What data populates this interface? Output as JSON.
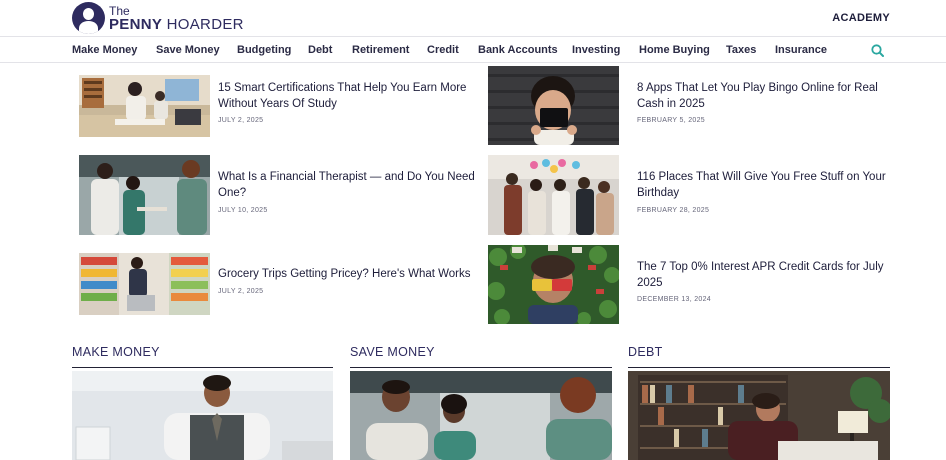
{
  "header": {
    "logo_the": "The",
    "logo_penny": "PENNY",
    "logo_hoarder": "HOARDER",
    "academy": "ACADEMY"
  },
  "nav": {
    "items": [
      "Make Money",
      "Save Money",
      "Budgeting",
      "Debt",
      "Retirement",
      "Credit",
      "Bank Accounts",
      "Investing",
      "Home Buying",
      "Taxes",
      "Insurance"
    ],
    "search_icon": "search-icon",
    "accent": "#2aa7a0"
  },
  "articles_left": [
    {
      "title": "15 Smart Certifications That Help You Earn More Without Years Of Study",
      "date": "JULY 2, 2025"
    },
    {
      "title": "What Is a Financial Therapist — and Do You Need One?",
      "date": "JULY 10, 2025"
    },
    {
      "title": "Grocery Trips Getting Pricey? Here's What Works",
      "date": "JULY 2, 2025"
    }
  ],
  "articles_right": [
    {
      "title": "8 Apps That Let You Play Bingo Online for Real Cash in 2025",
      "date": "FEBRUARY 5, 2025"
    },
    {
      "title": "116 Places That Will Give You Free Stuff on Your Birthday",
      "date": "FEBRUARY 28, 2025"
    },
    {
      "title": "The 7 Top 0% Interest APR Credit Cards for July 2025",
      "date": "DECEMBER 13, 2024"
    }
  ],
  "sections": [
    "MAKE MONEY",
    "SAVE MONEY",
    "DEBT"
  ],
  "colors": {
    "brand": "#2e2b5f",
    "text": "#1d1d3a"
  }
}
